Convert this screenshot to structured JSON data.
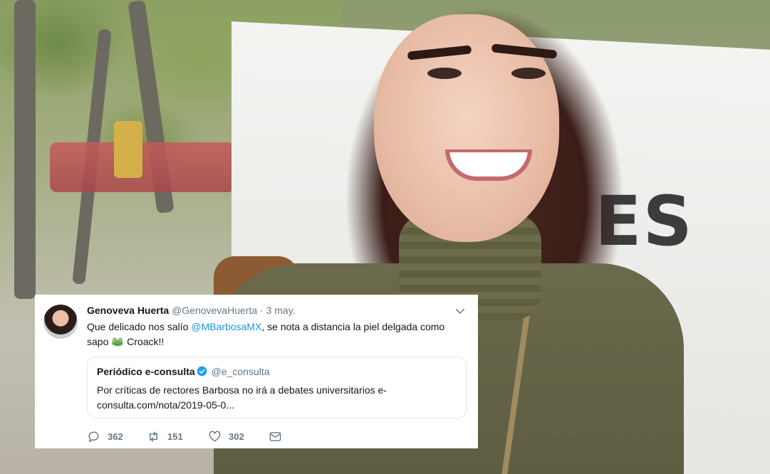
{
  "background": {
    "sign_text": "ES"
  },
  "tweet": {
    "author_name": "Genoveva Huerta",
    "author_handle": "@GenovevaHuerta",
    "separator": "·",
    "time": "3 may.",
    "text_before": "Que delicado nos salío ",
    "mention": "@MBarbosaMX",
    "text_after": ", se nota a distancia la piel delgada como sapo ",
    "text_end": " Croack!!",
    "emoji": "frog-icon",
    "quote": {
      "name": "Periódico e-consulta",
      "handle": "@e_consulta",
      "text": "Por críticas de rectores Barbosa no irá a debates universitarios e-consulta.com/nota/2019-05-0..."
    },
    "actions": {
      "replies": "362",
      "retweets": "151",
      "likes": "302"
    }
  },
  "colors": {
    "link": "#1b95e0",
    "secondary": "#657786",
    "text": "#14171a",
    "verified": "#1da1f2"
  }
}
